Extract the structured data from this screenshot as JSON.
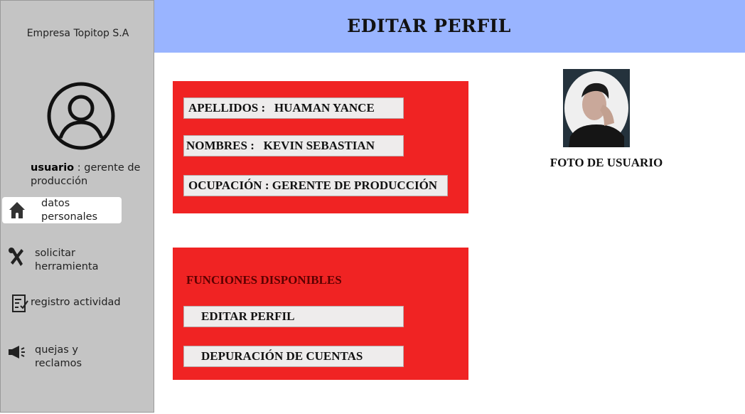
{
  "sidebar": {
    "company": "Empresa Topitop S.A",
    "role_label": "usuario",
    "role_value": " : gerente de producción",
    "items": [
      {
        "label": "datos personales",
        "icon": "home-icon"
      },
      {
        "label": "solicitar herramienta",
        "icon": "tools-icon"
      },
      {
        "label": "registro actividad",
        "icon": "document-icon"
      },
      {
        "label": "quejas y reclamos",
        "icon": "megaphone-icon"
      }
    ]
  },
  "header": {
    "title": "EDITAR PERFIL"
  },
  "profile": {
    "apellidos": "APELLIDOS :   HUAMAN YANCE",
    "nombres": "NOMBRES :   KEVIN SEBASTIAN",
    "ocupacion": "OCUPACIÓN : GERENTE DE PRODUCCIÓN"
  },
  "functions": {
    "title": "FUNCIONES DISPONIBLES",
    "buttons": [
      "EDITAR PERFIL",
      "DEPURACIÓN DE CUENTAS"
    ]
  },
  "photo": {
    "caption": "FOTO DE USUARIO"
  },
  "colors": {
    "header": "#99b4ff",
    "sidebar": "#c4c4c4",
    "panel": "#f02323",
    "field": "#eeecec"
  }
}
